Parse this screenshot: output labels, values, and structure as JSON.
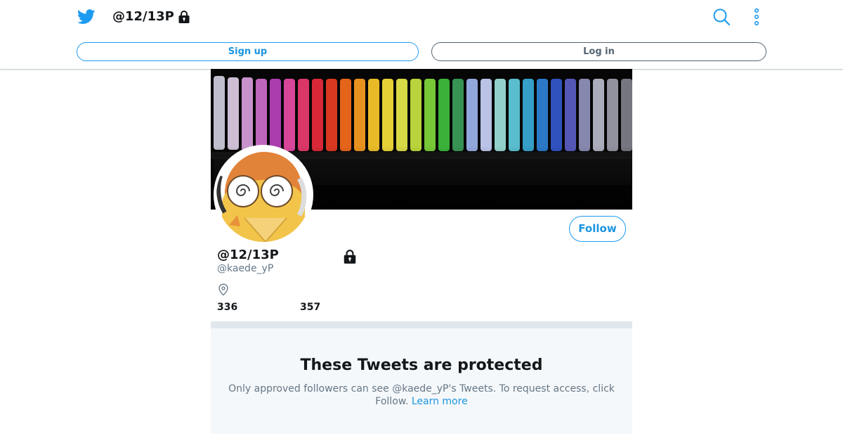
{
  "header": {
    "title": "@12/13P",
    "signup_label": "Sign up",
    "login_label": "Log in"
  },
  "profile": {
    "display_name": "@12/13P",
    "handle": "@kaede_yP",
    "follow_label": "Follow",
    "following_count": "336",
    "followers_count": "357"
  },
  "protected_notice": {
    "heading": "These Tweets are protected",
    "body": "Only approved followers can see @kaede_yP's Tweets. To request access, click Follow.",
    "learn_more": "Learn more"
  },
  "colors": {
    "accent": "#1b95e0",
    "secondary_text": "#657786",
    "divider": "#e1e8ed",
    "notice_bg": "#f5f8fa"
  },
  "icons": {
    "logo": "twitter-bird-icon",
    "protected": "lock-icon",
    "search": "search-icon",
    "more": "more-vertical-icon",
    "location": "location-pin-icon"
  }
}
